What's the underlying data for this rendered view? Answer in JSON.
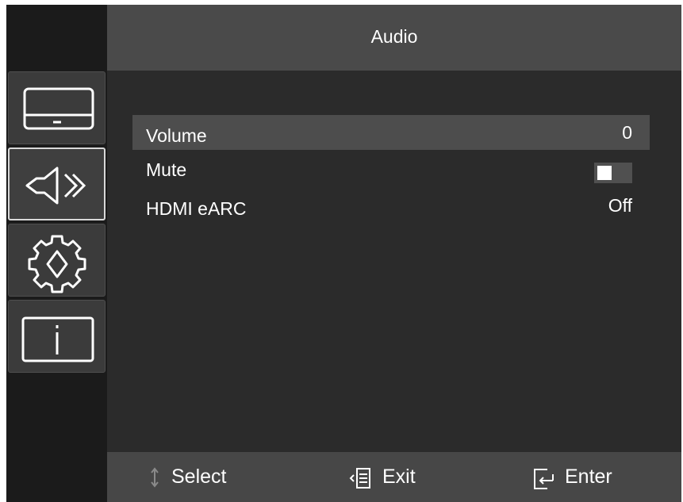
{
  "header": {
    "title": "Audio"
  },
  "sidebar": {
    "tabs": [
      {
        "icon": "monitor-icon",
        "active": false
      },
      {
        "icon": "speaker-icon",
        "active": true
      },
      {
        "icon": "gear-icon",
        "active": false
      },
      {
        "icon": "info-icon",
        "active": false
      }
    ]
  },
  "menu": {
    "items": [
      {
        "label": "Volume",
        "value": "0",
        "selected": true
      },
      {
        "label": "Mute",
        "toggle": "off"
      },
      {
        "label": "HDMI eARC",
        "value": "Off"
      }
    ]
  },
  "footer": {
    "select_label": "Select",
    "exit_label": "Exit",
    "enter_label": "Enter"
  }
}
